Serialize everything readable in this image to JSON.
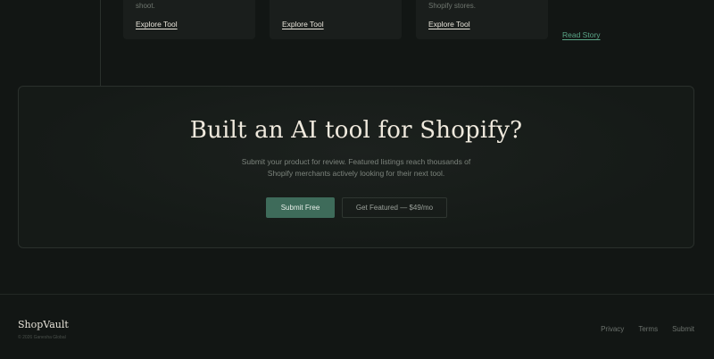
{
  "cards": [
    {
      "text": "shoot.",
      "link": "Explore Tool"
    },
    {
      "text": "",
      "link": "Explore Tool"
    },
    {
      "text": "Shopify stores.",
      "link": "Explore Tool"
    }
  ],
  "read_story": "Read Story",
  "cta": {
    "title": "Built an AI tool for Shopify?",
    "subtitle_line1": "Submit your product for review. Featured listings reach thousands of",
    "subtitle_line2": "Shopify merchants actively looking for their next tool.",
    "primary_label": "Submit Free",
    "secondary_label": "Get Featured — $49/mo"
  },
  "footer": {
    "brand": "ShopVault",
    "copyright": "© 2026 Ganesha Global",
    "links": [
      "Privacy",
      "Terms",
      "Submit"
    ]
  },
  "colors": {
    "background": "#121614",
    "accent": "#3e6b5a",
    "link_accent": "#5aa587"
  }
}
